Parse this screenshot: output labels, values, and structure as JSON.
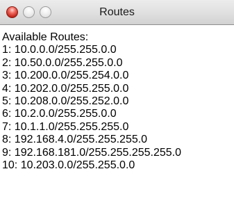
{
  "window": {
    "title": "Routes"
  },
  "content": {
    "heading": "Available Routes:",
    "routes": [
      "1: 10.0.0.0/255.255.0.0",
      "2: 10.50.0.0/255.255.0.0",
      "3: 10.200.0.0/255.254.0.0",
      "4: 10.202.0.0/255.255.0.0",
      "5: 10.208.0.0/255.252.0.0",
      "6: 10.2.0.0/255.255.0.0",
      "7: 10.1.1.0/255.255.255.0",
      "8: 192.168.4.0/255.255.255.0",
      "9: 192.168.181.0/255.255.255.255.0",
      "10: 10.203.0.0/255.255.0.0"
    ]
  },
  "colors": {
    "close_button": "#e0443a",
    "window_background": "#ffffff",
    "text": "#000000"
  },
  "icons": {
    "close": "close-button-icon",
    "minimize": "minimize-button-icon",
    "zoom": "zoom-button-icon"
  }
}
